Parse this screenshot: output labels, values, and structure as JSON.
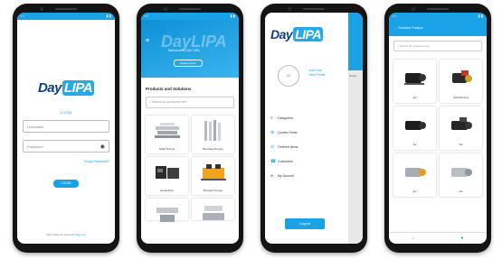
{
  "colors": {
    "accent": "#1aa2e6",
    "brand_dark": "#0c3f88"
  },
  "login": {
    "brand_day": "Day",
    "brand_lipa": "LIPA",
    "title": "LOGIN",
    "username_placeholder": "Username",
    "password_placeholder": "Password",
    "forgot": "Forgot Password?",
    "login_button": "LOGIN",
    "footer_text": "Don't have an account?",
    "footer_link": "Sign Up"
  },
  "home": {
    "welcome": "Welcome to DAY LIPA",
    "pill": "Explore Now",
    "section_title": "Products and Solutions",
    "search_placeholder": "Search for products here",
    "cards": [
      {
        "label": "Solar Pumps"
      },
      {
        "label": "Borehole Pumps"
      },
      {
        "label": "Generators"
      },
      {
        "label": "Booster Pumps"
      }
    ]
  },
  "drawer": {
    "brand_day": "Day",
    "brand_lipa": "LIPA",
    "avatar_label": "JD",
    "user_line1": "John Doe",
    "user_line2": "View Profile",
    "menu": [
      {
        "icon": "list-icon",
        "glyph": "≡",
        "label": "Categories"
      },
      {
        "icon": "cart-icon",
        "glyph": "⊕",
        "label": "Quotes Home"
      },
      {
        "icon": "history-icon",
        "glyph": "⊙",
        "label": "Ordered Items"
      },
      {
        "icon": "phone-icon",
        "glyph": "☎",
        "label": "Customers"
      },
      {
        "icon": "user-icon",
        "glyph": "●",
        "label": "My Account"
      }
    ],
    "logout": "Logout",
    "peek_heading": "Produ"
  },
  "products": {
    "title": "Surface Pumps",
    "search_placeholder": "Search for products here",
    "items": [
      {
        "label": "Jet"
      },
      {
        "label": "Self-Priming"
      },
      {
        "label": "Jet"
      },
      {
        "label": "Jet"
      },
      {
        "label": "Jet"
      },
      {
        "label": "Jet"
      }
    ]
  }
}
